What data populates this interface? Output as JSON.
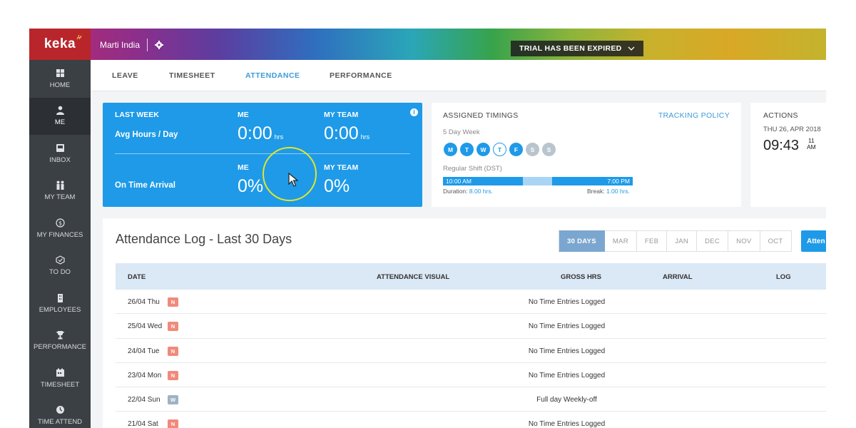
{
  "app": {
    "logo": "keka",
    "org_name": "Marti India",
    "trial_banner": "TRIAL HAS BEEN EXPIRED"
  },
  "sidebar": {
    "items": [
      {
        "label": "HOME",
        "icon": "home-icon"
      },
      {
        "label": "ME",
        "icon": "user-icon",
        "active": true
      },
      {
        "label": "INBOX",
        "icon": "inbox-icon"
      },
      {
        "label": "MY TEAM",
        "icon": "team-icon"
      },
      {
        "label": "MY FINANCES",
        "icon": "dollar-icon"
      },
      {
        "label": "TO DO",
        "icon": "todo-icon"
      },
      {
        "label": "EMPLOYEES",
        "icon": "building-icon"
      },
      {
        "label": "PERFORMANCE",
        "icon": "trophy-icon"
      },
      {
        "label": "TIMESHEET",
        "icon": "timesheet-icon"
      },
      {
        "label": "TIME ATTEND",
        "icon": "clock-icon"
      }
    ]
  },
  "tabs": {
    "leave": "LEAVE",
    "timesheet": "TIMESHEET",
    "attendance": "ATTENDANCE",
    "performance": "PERFORMANCE",
    "active": "ATTENDANCE"
  },
  "stats": {
    "period": "LAST WEEK",
    "me": "ME",
    "my_team": "MY TEAM",
    "avg_label": "Avg Hours / Day",
    "avg_me": "0:00",
    "avg_team": "0:00",
    "unit": "hrs",
    "ontime_label": "On Time Arrival",
    "ontime_me": "0%",
    "ontime_team": "0%"
  },
  "timings": {
    "title": "ASSIGNED TIMINGS",
    "policy_link": "TRACKING POLICY",
    "week": "5 Day Week",
    "days": [
      {
        "d": "M",
        "kind": "work"
      },
      {
        "d": "T",
        "kind": "work"
      },
      {
        "d": "W",
        "kind": "work"
      },
      {
        "d": "T",
        "kind": "off"
      },
      {
        "d": "F",
        "kind": "work"
      },
      {
        "d": "S",
        "kind": "half"
      },
      {
        "d": "S",
        "kind": "half"
      }
    ],
    "shift": "Regular Shift (DST)",
    "start": "10:00 AM",
    "end": "7:00 PM",
    "duration_label": "Duration:",
    "duration": "8.00 hrs.",
    "break_label": "Break:",
    "break": "1.00 hrs."
  },
  "actions": {
    "title": "ACTIONS",
    "date": "THU 26, APR 2018",
    "time": "09:43",
    "seconds": "11",
    "ampm": "AM"
  },
  "log": {
    "title": "Attendance Log - Last 30 Days",
    "filters": [
      "30 DAYS",
      "MAR",
      "FEB",
      "JAN",
      "DEC",
      "NOV",
      "OCT"
    ],
    "active_filter": "30 DAYS",
    "button": "Atten",
    "columns": {
      "date": "DATE",
      "visual": "ATTENDANCE VISUAL",
      "gross": "GROSS HRS",
      "arrival": "ARRIVAL",
      "log": "LOG"
    },
    "rows": [
      {
        "date": "26/04 Thu",
        "badge": "N",
        "message": "No Time Entries Logged"
      },
      {
        "date": "25/04 Wed",
        "badge": "N",
        "message": "No Time Entries Logged"
      },
      {
        "date": "24/04 Tue",
        "badge": "N",
        "message": "No Time Entries Logged"
      },
      {
        "date": "23/04 Mon",
        "badge": "N",
        "message": "No Time Entries Logged"
      },
      {
        "date": "22/04 Sun",
        "badge": "W",
        "message": "Full day Weekly-off"
      },
      {
        "date": "21/04 Sat",
        "badge": "N",
        "message": "No Time Entries Logged"
      }
    ]
  },
  "colors": {
    "brand_red": "#b8262b",
    "accent_blue": "#1e9ae8",
    "sidebar_bg": "#3b4045",
    "badge_n": "#f08a7b",
    "badge_w": "#9fb2c5"
  }
}
